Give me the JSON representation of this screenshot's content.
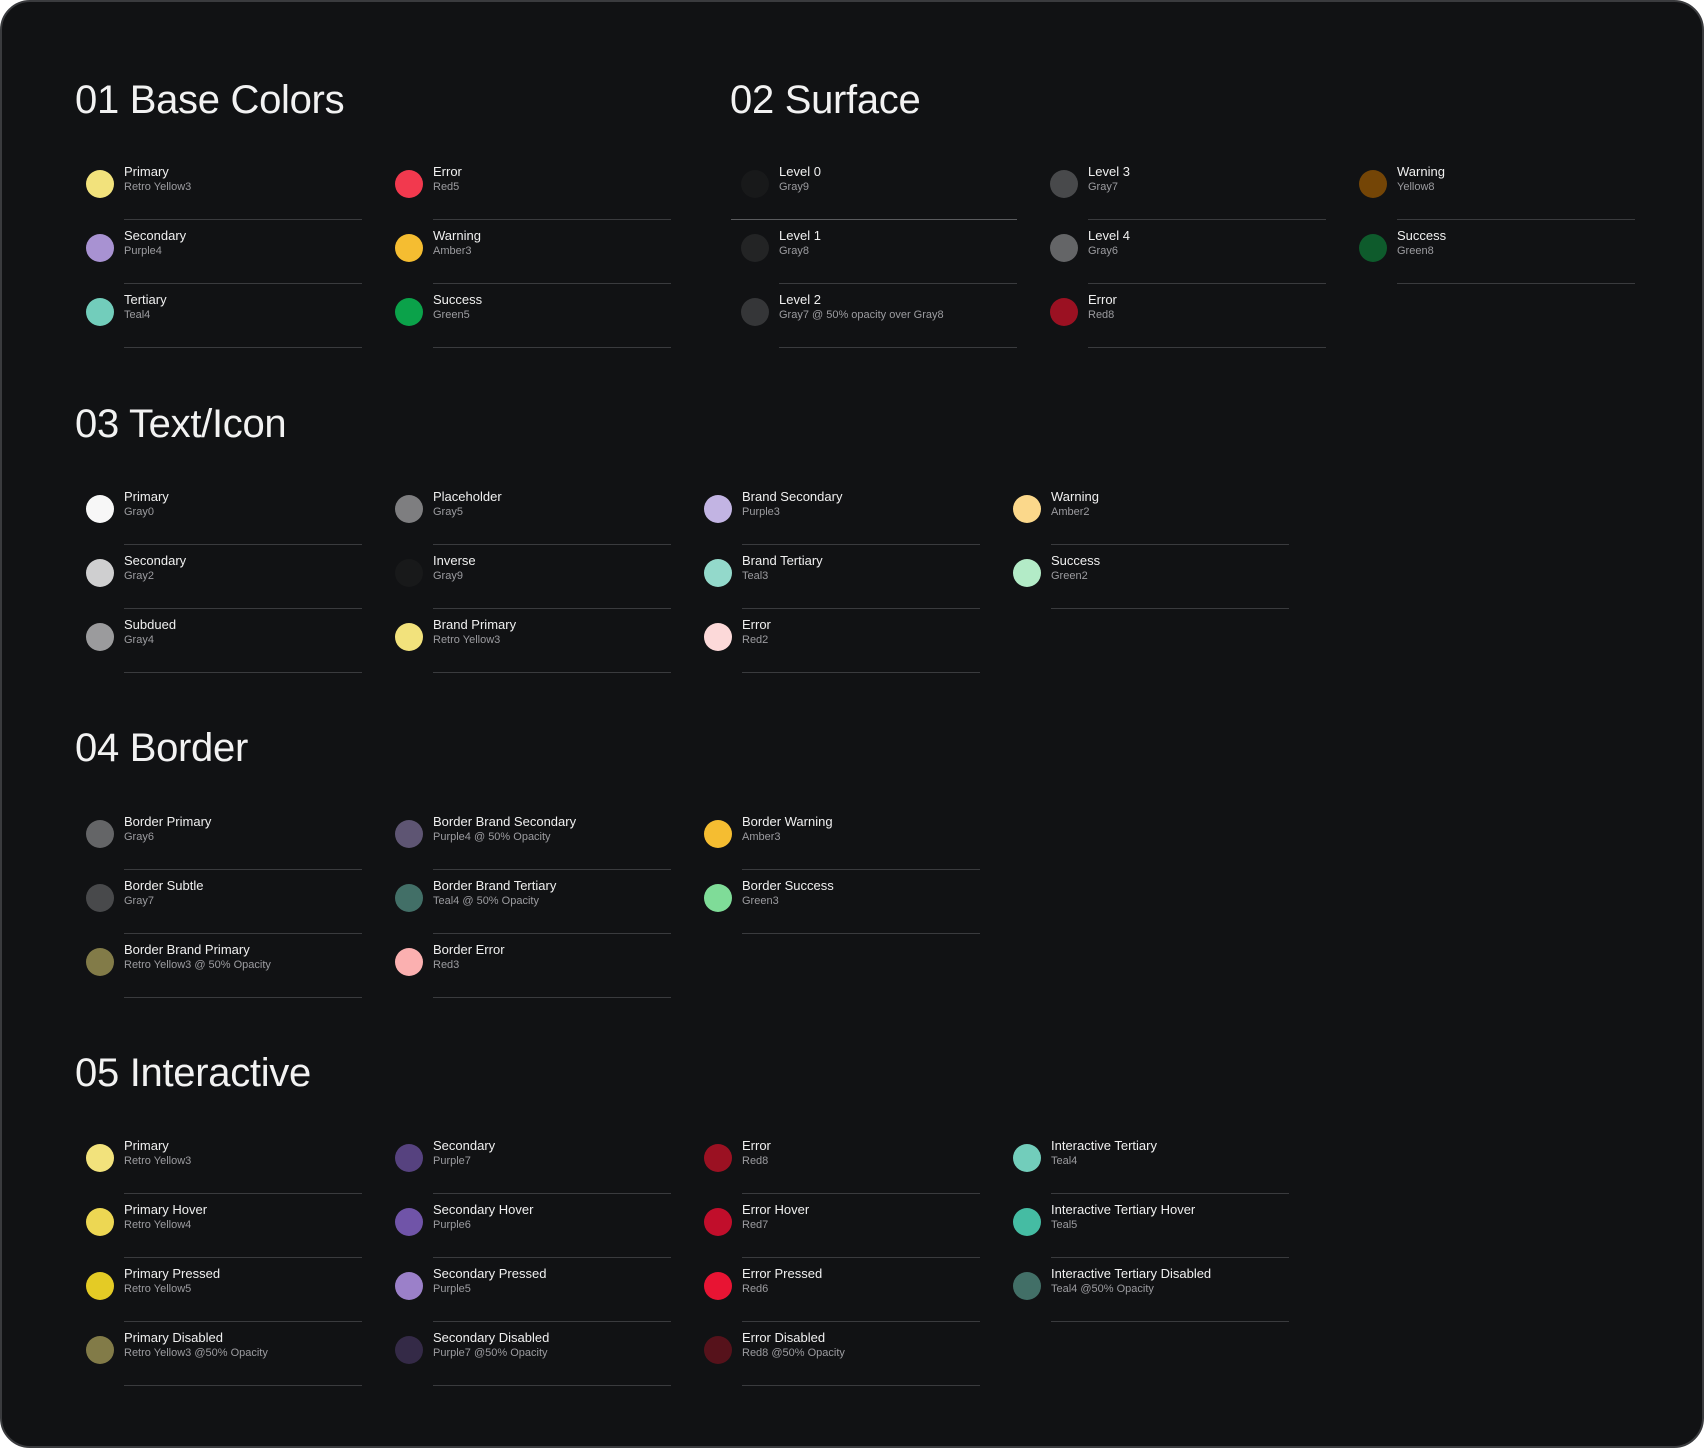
{
  "sections": [
    {
      "id": "base-colors",
      "title": "01 Base Colors",
      "columns": [
        [
          {
            "name": "Primary",
            "token": "Retro Yellow3",
            "color": "#F2E27C"
          },
          {
            "name": "Secondary",
            "token": "Purple4",
            "color": "#A892D2"
          },
          {
            "name": "Tertiary",
            "token": "Teal4",
            "color": "#72CDBB"
          }
        ],
        [
          {
            "name": "Error",
            "token": "Red5",
            "color": "#F2394E"
          },
          {
            "name": "Warning",
            "token": "Amber3",
            "color": "#F5BD31"
          },
          {
            "name": "Success",
            "token": "Green5",
            "color": "#0BA24A"
          }
        ]
      ]
    },
    {
      "id": "surface",
      "title": "02 Surface",
      "columns": [
        [
          {
            "name": "Level 0",
            "token": "Gray9",
            "color": "#18191A"
          },
          {
            "name": "Level 1",
            "token": "Gray8",
            "color": "#232425"
          },
          {
            "name": "Level 2",
            "token": "Gray7 @ 50% opacity over Gray8",
            "color": "#353638"
          }
        ],
        [
          {
            "name": "Level 3",
            "token": "Gray7",
            "color": "#48494B"
          },
          {
            "name": "Level 4",
            "token": "Gray6",
            "color": "#646567"
          },
          {
            "name": "Error",
            "token": "Red8",
            "color": "#9B1122"
          }
        ],
        [
          {
            "name": "Warning",
            "token": "Yellow8",
            "color": "#744506"
          },
          {
            "name": "Success",
            "token": "Green8",
            "color": "#0E5B2C"
          }
        ]
      ]
    },
    {
      "id": "text-icon",
      "title": "03 Text/Icon",
      "columns": [
        [
          {
            "name": "Primary",
            "token": "Gray0",
            "color": "#F7F7F7"
          },
          {
            "name": "Secondary",
            "token": "Gray2",
            "color": "#CFCFD0"
          },
          {
            "name": "Subdued",
            "token": "Gray4",
            "color": "#9B9B9D"
          }
        ],
        [
          {
            "name": "Placeholder",
            "token": "Gray5",
            "color": "#7E7E80"
          },
          {
            "name": "Inverse",
            "token": "Gray9",
            "color": "#18191A"
          },
          {
            "name": "Brand Primary",
            "token": "Retro Yellow3",
            "color": "#F2E27C"
          }
        ],
        [
          {
            "name": "Brand Secondary",
            "token": "Purple3",
            "color": "#C2B4E3"
          },
          {
            "name": "Brand Tertiary",
            "token": "Teal3",
            "color": "#93D9CB"
          },
          {
            "name": "Error",
            "token": "Red2",
            "color": "#FCD9D9"
          }
        ],
        [
          {
            "name": "Warning",
            "token": "Amber2",
            "color": "#FBD88B"
          },
          {
            "name": "Success",
            "token": "Green2",
            "color": "#B3EBC7"
          }
        ]
      ]
    },
    {
      "id": "border",
      "title": "04 Border",
      "columns": [
        [
          {
            "name": "Border Primary",
            "token": "Gray6",
            "color": "#646567"
          },
          {
            "name": "Border Subtle",
            "token": "Gray7",
            "color": "#48494B"
          },
          {
            "name": "Border Brand Primary",
            "token": "Retro Yellow3 @ 50% Opacity",
            "color": "#827B48"
          }
        ],
        [
          {
            "name": "Border Brand Secondary",
            "token": "Purple4 @ 50% Opacity",
            "color": "#5E5573"
          },
          {
            "name": "Border Brand Tertiary",
            "token": "Teal4 @ 50% Opacity",
            "color": "#426F67"
          },
          {
            "name": "Border Error",
            "token": "Red3",
            "color": "#FBB0B0"
          }
        ],
        [
          {
            "name": "Border Warning",
            "token": "Amber3",
            "color": "#F5BD31"
          },
          {
            "name": "Border Success",
            "token": "Green3",
            "color": "#7FDC98"
          }
        ]
      ]
    },
    {
      "id": "interactive",
      "title": "05 Interactive",
      "columns": [
        [
          {
            "name": "Primary",
            "token": "Retro Yellow3",
            "color": "#F2E27C"
          },
          {
            "name": "Primary Hover",
            "token": "Retro Yellow4",
            "color": "#EDD753"
          },
          {
            "name": "Primary Pressed",
            "token": "Retro Yellow5",
            "color": "#E4CB25"
          },
          {
            "name": "Primary Disabled",
            "token": "Retro Yellow3 @50% Opacity",
            "color": "#827B48"
          }
        ],
        [
          {
            "name": "Secondary",
            "token": "Purple7",
            "color": "#56427F"
          },
          {
            "name": "Secondary Hover",
            "token": "Purple6",
            "color": "#7054A8"
          },
          {
            "name": "Secondary Pressed",
            "token": "Purple5",
            "color": "#9B80C9"
          },
          {
            "name": "Secondary Disabled",
            "token": "Purple7 @50% Opacity",
            "color": "#342A47"
          }
        ],
        [
          {
            "name": "Error",
            "token": "Red8",
            "color": "#9B1122"
          },
          {
            "name": "Error Hover",
            "token": "Red7",
            "color": "#C10E2B"
          },
          {
            "name": "Error Pressed",
            "token": "Red6",
            "color": "#E81433"
          },
          {
            "name": "Error Disabled",
            "token": "Red8 @50% Opacity",
            "color": "#56121B"
          }
        ],
        [
          {
            "name": "Interactive Tertiary",
            "token": "Teal4",
            "color": "#72CDBB"
          },
          {
            "name": "Interactive Tertiary Hover",
            "token": "Teal5",
            "color": "#45BCA3"
          },
          {
            "name": "Interactive Tertiary Disabled",
            "token": "Teal4 @50% Opacity",
            "color": "#426F67"
          }
        ]
      ]
    }
  ]
}
